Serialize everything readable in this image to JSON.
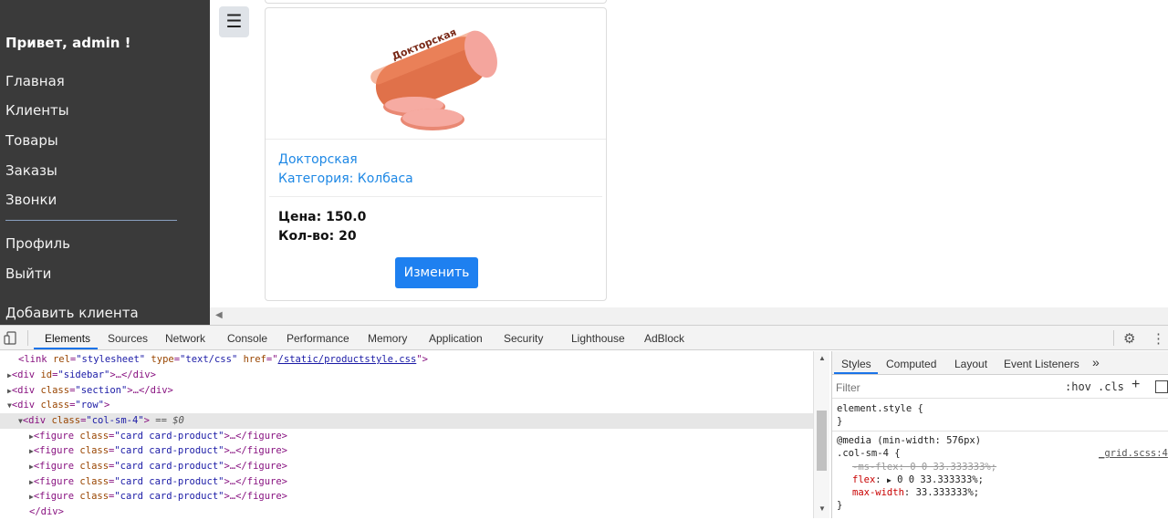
{
  "sidebar": {
    "greeting": "Привет, admin !",
    "items": [
      "Главная",
      "Клиенты",
      "Товары",
      "Заказы",
      "Звонки"
    ],
    "items2": [
      "Профиль",
      "Выйти"
    ],
    "add_client": "Добавить клиента"
  },
  "product": {
    "image_label": "Докторская",
    "name": "Докторская",
    "category": "Категория: Колбаса",
    "price": "Цена: 150.0",
    "qty": "Кол-во: 20",
    "edit_label": "Изменить"
  },
  "devtools": {
    "tabs": [
      "Elements",
      "Sources",
      "Network",
      "Console",
      "Performance",
      "Memory",
      "Application",
      "Security",
      "Lighthouse",
      "AdBlock"
    ],
    "active_tab": "Elements",
    "dom_lines": {
      "l0_tag": "<link",
      "l0_a1": "rel",
      "l0_v1": "\"stylesheet\"",
      "l0_a2": "type",
      "l0_v2": "\"text/css\"",
      "l0_a3": "href",
      "l0_v3": "/static/productstyle.css",
      "l1_open": "<div",
      "l1_attr": "id",
      "l1_val": "\"sidebar\"",
      "l1_rest": ">…</div>",
      "l2_open": "<div",
      "l2_attr": "class",
      "l2_val": "\"section\"",
      "l2_rest": ">…</div>",
      "l3_open": "<div",
      "l3_attr": "class",
      "l3_val": "\"row\"",
      "l3_rest": ">",
      "l4_open": "<div",
      "l4_attr": "class",
      "l4_val": "\"col-sm-4\"",
      "l4_rest": ">",
      "l4_eq": "== $0",
      "fig_open": "<figure",
      "fig_attr": "class",
      "fig_val": "\"card card-product\"",
      "fig_rest": ">…</figure>",
      "close_div": "</div>"
    },
    "styles": {
      "tabs": [
        "Styles",
        "Computed",
        "Layout",
        "Event Listeners"
      ],
      "more": "»",
      "filter_placeholder": "Filter",
      "hov": ":hov",
      "cls": ".cls",
      "plus": "+",
      "element_style": "element.style {",
      "close_brace": "}",
      "media": "@media (min-width: 576px)",
      "selector": ".col-sm-4 {",
      "source": "_grid.scss:4",
      "p1_name": "-ms-flex",
      "p1_val": "0 0 33.333333%;",
      "p2_name": "flex",
      "p2_val": "0 0 33.333333%;",
      "p3_name": "max-width",
      "p3_val": "33.333333%;"
    }
  },
  "colors": {
    "sidebar_bg": "#3a3a3a",
    "link": "#1e88e5",
    "button": "#1e80f0",
    "devtools_accent": "#1a73e8"
  }
}
